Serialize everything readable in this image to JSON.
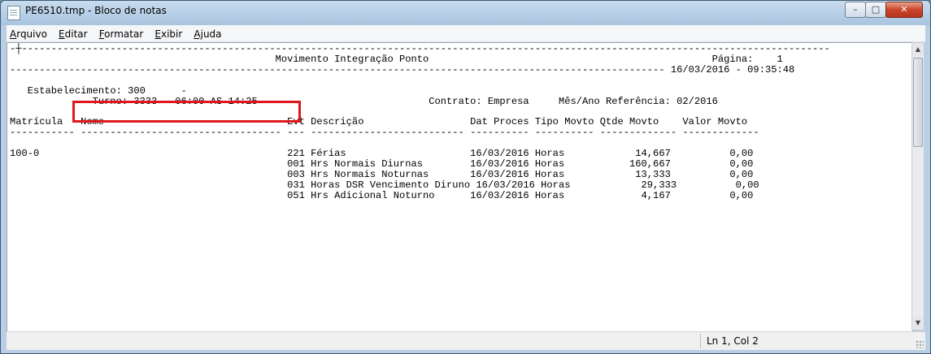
{
  "window": {
    "title": "PE6510.tmp - Bloco de notas",
    "controls": {
      "minimize": "–",
      "maximize": "□",
      "close": "✕"
    }
  },
  "menu": {
    "items": [
      {
        "accel": "A",
        "rest": "rquivo"
      },
      {
        "accel": "E",
        "rest": "ditar"
      },
      {
        "accel": "F",
        "rest": "ormatar"
      },
      {
        "accel": "E",
        "rest": "xibir"
      },
      {
        "accel": "Aj",
        "rest": "uda"
      }
    ]
  },
  "document": {
    "lines": [
      "-┼-----------------------------------------------------------------------------------------------------------------------------------------",
      "                                             Movimento Integração Ponto                                                Página:    1",
      "--------------------------------------------------------------------------------------------------------------- 16/03/2016 - 09:35:48",
      "",
      "   Estabelecimento: 300      -",
      "              Turno: 3333 - 06:00 AS 14:25                             Contrato: Empresa     Mês/Ano Referência: 02/2016",
      "",
      "Matrícula   Nome                               Evt Descrição                  Dat Proces Tipo Movto Qtde Movto    Valor Movto",
      "----------- ---------------------------------- --- -------------------------- ---------- ---------- ------------- -------------",
      "",
      "100-0                                          221 Férias                     16/03/2016 Horas            14,667          0,00",
      "                                               001 Hrs Normais Diurnas        16/03/2016 Horas           160,667          0,00",
      "                                               003 Hrs Normais Noturnas       16/03/2016 Horas            13,333          0,00",
      "                                               031 Horas DSR Vencimento Diruno 16/03/2016 Horas            29,333          0,00",
      "                                               051 Hrs Adicional Noturno      16/03/2016 Horas             4,167          0,00"
    ]
  },
  "scrollbar": {
    "up": "▲",
    "down": "▼"
  },
  "status": {
    "position": "Ln 1, Col 2"
  }
}
